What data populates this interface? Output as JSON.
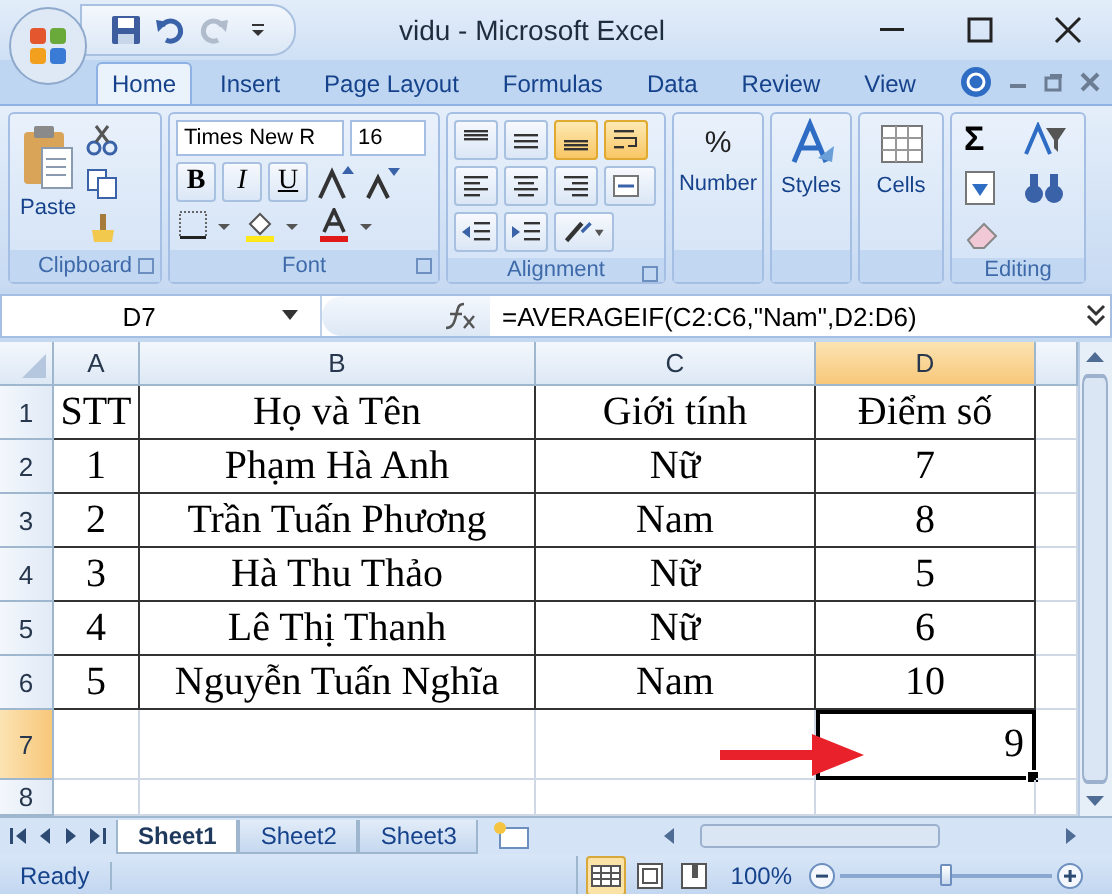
{
  "window": {
    "title": "vidu - Microsoft Excel"
  },
  "quick_access": [
    {
      "kind": "save",
      "disabled": false
    },
    {
      "kind": "undo",
      "disabled": false
    },
    {
      "kind": "redo",
      "disabled": true
    }
  ],
  "ribbon_tabs": [
    {
      "label": "Home",
      "selected": true
    },
    {
      "label": "Insert",
      "selected": false
    },
    {
      "label": "Page Layout",
      "selected": false
    },
    {
      "label": "Formulas",
      "selected": false
    },
    {
      "label": "Data",
      "selected": false
    },
    {
      "label": "Review",
      "selected": false
    },
    {
      "label": "View",
      "selected": false
    }
  ],
  "ribbon": {
    "clipboard": {
      "paste": "Paste",
      "label": "Clipboard"
    },
    "font": {
      "name": "Times New R",
      "size": "16",
      "styles": [
        "B",
        "I",
        "U"
      ],
      "label": "Font"
    },
    "alignment": {
      "vertical": [
        {
          "selected": false
        },
        {
          "selected": false
        },
        {
          "selected": true
        }
      ],
      "wrap_text": true,
      "label": "Alignment"
    },
    "number": {
      "symbol": "%",
      "button": "Number"
    },
    "styles": {
      "button": "Styles"
    },
    "cells": {
      "button": "Cells"
    },
    "editing": {
      "symbol": "Σ",
      "label": "Editing"
    }
  },
  "formula_bar": {
    "name_box": "D7",
    "formula": "=AVERAGEIF(C2:C6,\"Nam\",D2:D6)"
  },
  "columns": [
    {
      "label": "A",
      "selected": false
    },
    {
      "label": "B",
      "selected": false
    },
    {
      "label": "C",
      "selected": false
    },
    {
      "label": "D",
      "selected": true
    }
  ],
  "rows": [
    {
      "number": "1",
      "selected": false,
      "kind": "table",
      "cells": {
        "a": "STT",
        "b": "Họ và Tên",
        "c": "Giới tính",
        "d": "Điểm số"
      }
    },
    {
      "number": "2",
      "selected": false,
      "kind": "table",
      "cells": {
        "a": "1",
        "b": "Phạm Hà Anh",
        "c": "Nữ",
        "d": "7"
      }
    },
    {
      "number": "3",
      "selected": false,
      "kind": "table",
      "cells": {
        "a": "2",
        "b": "Trần Tuấn Phương",
        "c": "Nam",
        "d": "8"
      }
    },
    {
      "number": "4",
      "selected": false,
      "kind": "table",
      "cells": {
        "a": "3",
        "b": "Hà Thu Thảo",
        "c": "Nữ",
        "d": "5"
      }
    },
    {
      "number": "5",
      "selected": false,
      "kind": "table",
      "cells": {
        "a": "4",
        "b": "Lê Thị Thanh",
        "c": "Nữ",
        "d": "6"
      }
    },
    {
      "number": "6",
      "selected": false,
      "kind": "table",
      "cells": {
        "a": "5",
        "b": "Nguyễn Tuấn Nghĩa",
        "c": "Nam",
        "d": "10"
      }
    },
    {
      "number": "7",
      "selected": true,
      "kind": "plain",
      "cells": {
        "d": "9"
      }
    },
    {
      "number": "8",
      "selected": false,
      "kind": "plain"
    }
  ],
  "sheet_tabs": [
    {
      "label": "Sheet1",
      "selected": true
    },
    {
      "label": "Sheet2",
      "selected": false
    },
    {
      "label": "Sheet3",
      "selected": false
    }
  ],
  "status_bar": {
    "status": "Ready",
    "views": [
      {
        "selected": true
      },
      {
        "selected": false
      },
      {
        "selected": false
      }
    ],
    "zoom": "100%",
    "zoom_slider": {
      "level": 0.5
    }
  }
}
